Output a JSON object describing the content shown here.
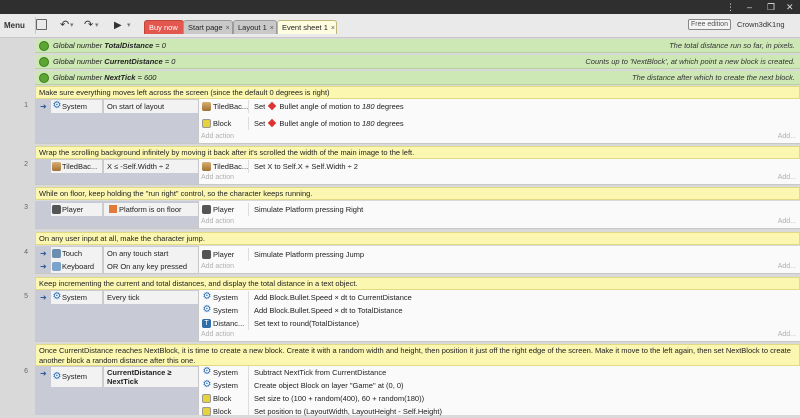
{
  "window": {
    "controls": [
      "⋮",
      "–",
      "❐",
      "✕"
    ]
  },
  "toolbar": {
    "menu": "Menu",
    "save_icon": "save-icon",
    "undo": "↶",
    "redo": "↷",
    "play": "▶",
    "tabs": [
      {
        "label": "Buy now",
        "close": "×"
      },
      {
        "label": "Start page",
        "close": "×"
      },
      {
        "label": "Layout 1",
        "close": "×"
      },
      {
        "label": "Event sheet 1",
        "close": "×"
      }
    ],
    "free_edition": "Free edition",
    "user": "Crown3dK1ng"
  },
  "globals": [
    {
      "prefix": "Global number ",
      "name": "TotalDistance",
      "suffix": " = 0",
      "desc": "The total distance run so far, in pixels."
    },
    {
      "prefix": "Global number ",
      "name": "CurrentDistance",
      "suffix": " = 0",
      "desc": "Counts up to 'NextBlock', at which point a new block is created."
    },
    {
      "prefix": "Global number ",
      "name": "NextTick",
      "suffix": " = 600",
      "desc": "The distance after which to create the next block."
    }
  ],
  "comments": [
    "Make sure everything moves left across the screen (since the default 0 degrees is right)",
    "Wrap the scrolling background infinitely by moving it back after it's scrolled the width of the main image to the left.",
    "While on floor, keep holding the \"run right\" control, so the character keeps running.",
    "On any user input at all, make the character jump.",
    "Keep incrementing the current and total distances, and display the total distance in a text object.",
    "Once CurrentDistance reaches NextBlock, it is time to create a new block.  Create it with a random width and height, then position it just off the right edge of the screen.  Make it move to the left again, then set NextBlock to create another block a random distance after this one."
  ],
  "add_action": "Add action",
  "add_right": "Add...",
  "events": [
    {
      "n": "1",
      "conditions": [
        {
          "obj": "System",
          "cond": "On start of layout"
        }
      ],
      "actions": [
        {
          "obj": "TiledBac...",
          "pre": "Set ",
          "post": " Bullet angle of motion to ",
          "val": "180",
          "tail": " degrees"
        },
        {
          "obj": "Block",
          "pre": "Set ",
          "post": " Bullet angle of motion to ",
          "val": "180",
          "tail": " degrees"
        }
      ]
    },
    {
      "n": "2",
      "conditions": [
        {
          "obj": "TiledBac...",
          "cond": "X ≤ -Self.Width ÷ 2"
        }
      ],
      "actions": [
        {
          "obj": "TiledBac...",
          "text": "Set X to Self.X + Self.Width ÷ 2"
        }
      ]
    },
    {
      "n": "3",
      "conditions": [
        {
          "obj": "Player",
          "cond": "Platform is on floor"
        }
      ],
      "actions": [
        {
          "obj": "Player",
          "text": "Simulate  Platform pressing Right"
        }
      ]
    },
    {
      "n": "4",
      "conditions": [
        {
          "obj": "Touch",
          "cond": "On any touch start"
        },
        {
          "obj": "Keyboard",
          "cond": "OR On any key pressed"
        }
      ],
      "actions": [
        {
          "obj": "Player",
          "text": "Simulate  Platform pressing Jump"
        }
      ]
    },
    {
      "n": "5",
      "conditions": [
        {
          "obj": "System",
          "cond": "Every tick"
        }
      ],
      "actions": [
        {
          "obj": "System",
          "text": "Add Block.Bullet.Speed × dt to CurrentDistance"
        },
        {
          "obj": "System",
          "text": "Add Block.Bullet.Speed × dt to TotalDistance"
        },
        {
          "obj": "Distanc...",
          "text": "Set text to round(TotalDistance)"
        }
      ]
    },
    {
      "n": "6",
      "conditions": [
        {
          "obj": "System",
          "cond": "CurrentDistance ≥ NextTick"
        }
      ],
      "actions": [
        {
          "obj": "System",
          "text": "Subtract NextTick from CurrentDistance"
        },
        {
          "obj": "System",
          "text": "Create object  Block on layer \"Game\" at (0, 0)"
        },
        {
          "obj": "Block",
          "text": "Set size to (100 + random(400), 60 + random(180))"
        },
        {
          "obj": "Block",
          "text": "Set position to (LayoutWidth, LayoutHeight - Self.Height)"
        }
      ]
    }
  ]
}
